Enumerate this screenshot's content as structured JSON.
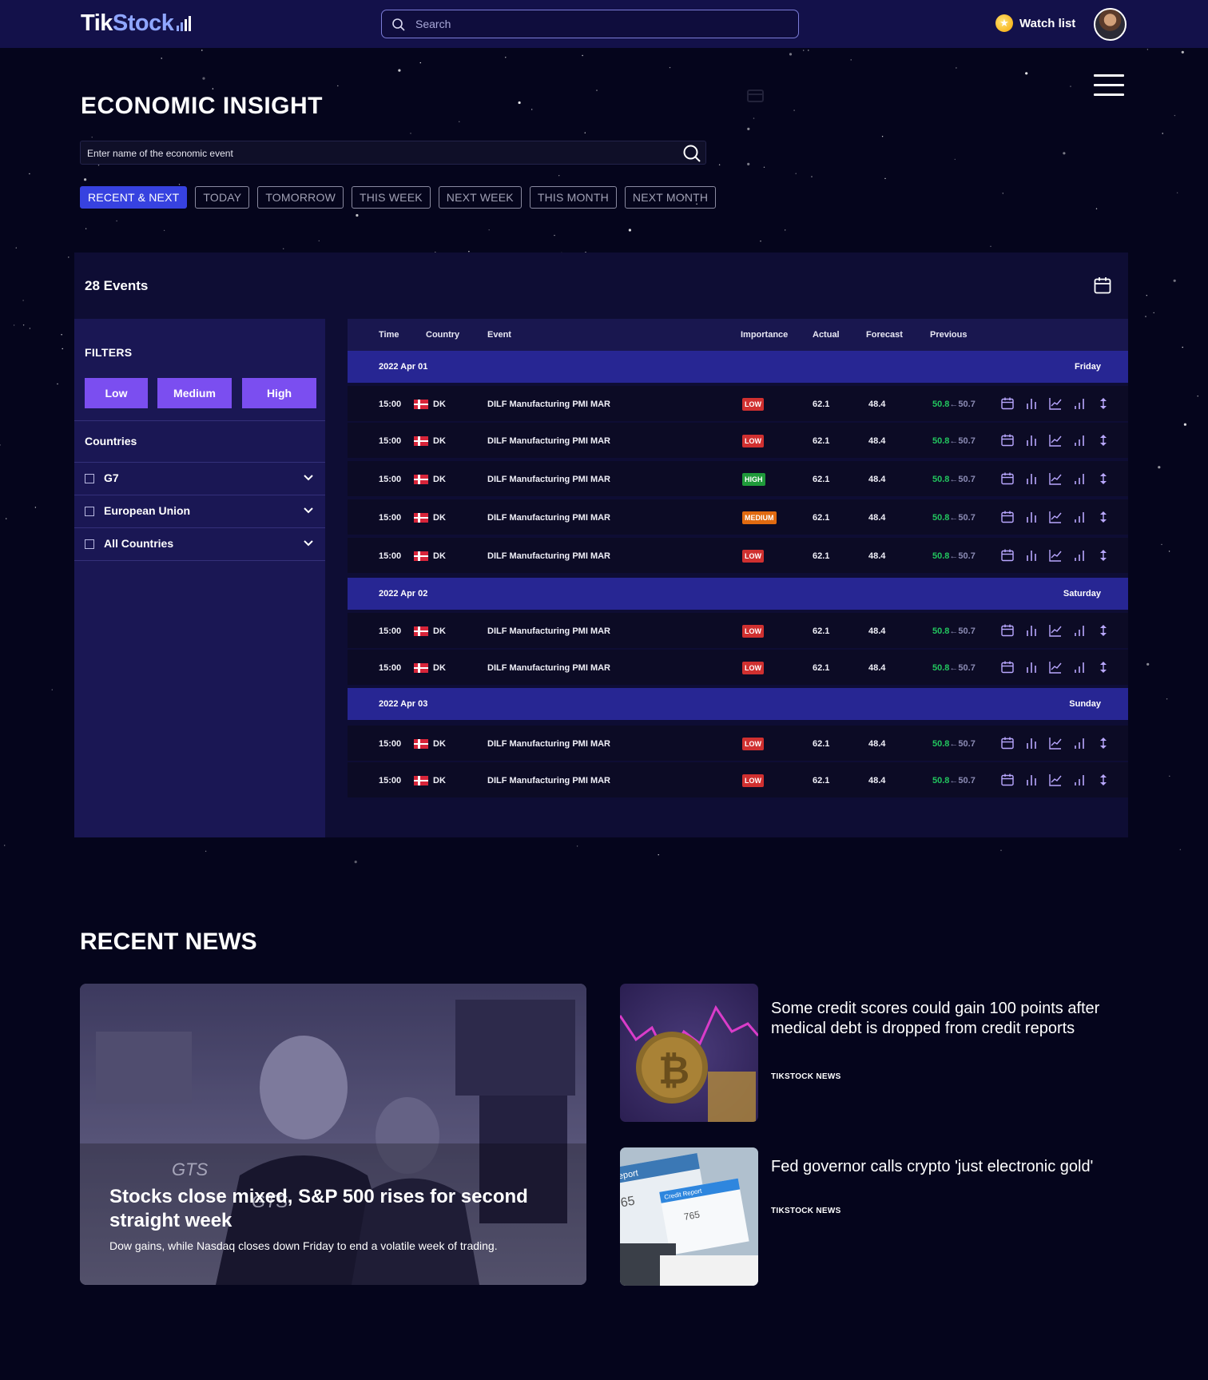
{
  "header": {
    "logo_tik": "Tik",
    "logo_stock": "Stock",
    "search_placeholder": "Search",
    "watchlist_label": "Watch list",
    "icons": [
      "search-icon",
      "coin-icon",
      "avatar",
      "menu-icon"
    ]
  },
  "page": {
    "title": "ECONOMIC INSIGHT",
    "event_search_placeholder": "Enter name of the economic event",
    "tabs": [
      {
        "label": "RECENT & NEXT",
        "active": true
      },
      {
        "label": "TODAY",
        "active": false
      },
      {
        "label": "TOMORROW",
        "active": false
      },
      {
        "label": "THIS WEEK",
        "active": false
      },
      {
        "label": "NEXT WEEK",
        "active": false
      },
      {
        "label": "THIS MONTH",
        "active": false
      },
      {
        "label": "NEXT MONTH",
        "active": false
      }
    ]
  },
  "events": {
    "count_label": "28 Events",
    "filters_label": "FILTERS",
    "importance_filters": [
      "Low",
      "Medium",
      "High"
    ],
    "countries_label": "Countries",
    "country_groups": [
      "G7",
      "European Union",
      "All Countries"
    ],
    "columns": [
      "Time",
      "Country",
      "Event",
      "Importance",
      "Actual",
      "Forecast",
      "Previous"
    ],
    "days": [
      {
        "date": "2022 Apr 01",
        "weekday": "Friday",
        "rows": [
          {
            "time": "15:00",
            "country": "DK",
            "event": "DILF Manufacturing PMI MAR",
            "importance": "LOW",
            "actual": "62.1",
            "forecast": "48.4",
            "previous_new": "50.8",
            "arrow": "←",
            "previous_old": "50.7"
          },
          {
            "time": "15:00",
            "country": "DK",
            "event": "DILF Manufacturing PMI MAR",
            "importance": "LOW",
            "actual": "62.1",
            "forecast": "48.4",
            "previous_new": "50.8",
            "arrow": "←",
            "previous_old": "50.7"
          },
          {
            "time": "15:00",
            "country": "DK",
            "event": "DILF Manufacturing PMI MAR",
            "importance": "HIGH",
            "actual": "62.1",
            "forecast": "48.4",
            "previous_new": "50.8",
            "arrow": "←",
            "previous_old": "50.7"
          },
          {
            "time": "15:00",
            "country": "DK",
            "event": "DILF Manufacturing PMI MAR",
            "importance": "MEDIUM",
            "actual": "62.1",
            "forecast": "48.4",
            "previous_new": "50.8",
            "arrow": "←",
            "previous_old": "50.7"
          },
          {
            "time": "15:00",
            "country": "DK",
            "event": "DILF Manufacturing PMI MAR",
            "importance": "LOW",
            "actual": "62.1",
            "forecast": "48.4",
            "previous_new": "50.8",
            "arrow": "←",
            "previous_old": "50.7"
          }
        ]
      },
      {
        "date": "2022 Apr 02",
        "weekday": "Saturday",
        "rows": [
          {
            "time": "15:00",
            "country": "DK",
            "event": "DILF Manufacturing PMI MAR",
            "importance": "LOW",
            "actual": "62.1",
            "forecast": "48.4",
            "previous_new": "50.8",
            "arrow": "←",
            "previous_old": "50.7"
          },
          {
            "time": "15:00",
            "country": "DK",
            "event": "DILF Manufacturing PMI MAR",
            "importance": "LOW",
            "actual": "62.1",
            "forecast": "48.4",
            "previous_new": "50.8",
            "arrow": "←",
            "previous_old": "50.7"
          }
        ]
      },
      {
        "date": "2022 Apr 03",
        "weekday": "Sunday",
        "rows": [
          {
            "time": "15:00",
            "country": "DK",
            "event": "DILF Manufacturing PMI MAR",
            "importance": "LOW",
            "actual": "62.1",
            "forecast": "48.4",
            "previous_new": "50.8",
            "arrow": "←",
            "previous_old": "50.7"
          },
          {
            "time": "15:00",
            "country": "DK",
            "event": "DILF Manufacturing PMI MAR",
            "importance": "LOW",
            "actual": "62.1",
            "forecast": "48.4",
            "previous_new": "50.8",
            "arrow": "←",
            "previous_old": "50.7"
          }
        ]
      }
    ],
    "row_action_icons": [
      "calendar-icon",
      "bar-chart-icon",
      "line-chart-icon",
      "signal-icon",
      "sort-icon"
    ]
  },
  "news": {
    "section_title": "RECENT NEWS",
    "featured": {
      "title": "Stocks close mixed, S&P 500 rises for second straight week",
      "subtitle": "Dow gains, while Nasdaq closes down Friday to end a volatile week of trading.",
      "image_text": "GTS"
    },
    "items": [
      {
        "title": "Some credit scores could gain 100 points after medical debt is dropped from credit reports",
        "source": "TIKSTOCK NEWS"
      },
      {
        "title": "Fed governor calls crypto 'just electronic gold'",
        "source": "TIKSTOCK NEWS",
        "image_text": [
          "Report",
          "Credit Report",
          "65",
          "765"
        ]
      }
    ]
  },
  "colors": {
    "background": "#05051c",
    "topbar": "#13114a",
    "accent_blue": "#3742e0",
    "filter_purple": "#7b4ef0",
    "date_row": "#272693",
    "low": "#d03030",
    "medium": "#e06a10",
    "high": "#1f9a3a",
    "positive": "#22c55e"
  }
}
